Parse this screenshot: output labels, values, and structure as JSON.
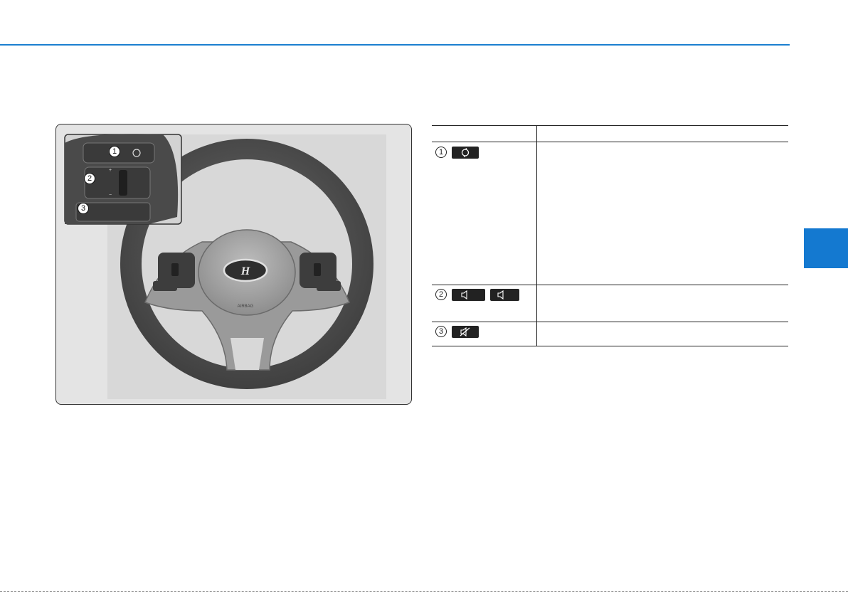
{
  "figure": {
    "callouts": [
      "1",
      "2",
      "3"
    ],
    "airbag_text": "AIRBAG"
  },
  "table": {
    "rows": [
      {
        "number": "1",
        "icons": [
          "mode-icon"
        ]
      },
      {
        "number": "2",
        "icons": [
          "volume-up-icon",
          "volume-down-icon"
        ]
      },
      {
        "number": "3",
        "icons": [
          "mute-icon"
        ]
      }
    ]
  },
  "colors": {
    "accent": "#1b7fd0",
    "section_tab": "#1479d0"
  }
}
